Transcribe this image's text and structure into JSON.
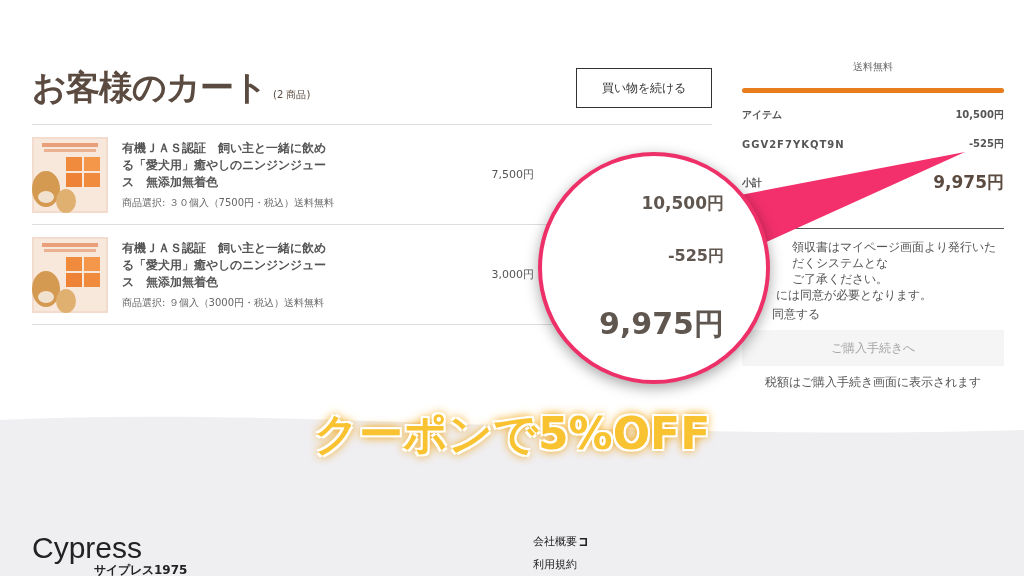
{
  "cart": {
    "title": "お客様のカート",
    "count": "(2 商品)",
    "continue_button": "買い物を続ける",
    "items": [
      {
        "kind": "picture",
        "name": "有機ＪＡＳ認証　飼い主と一緒に飲める「愛犬用」癒やしのニンジンジュース　無添加無着色",
        "option": "商品選択: ３０個入（7500円・税込）送料無料",
        "price": "7,500円"
      },
      {
        "kind": "picture",
        "name": "有機ＪＡＳ認証　飼い主と一緒に飲める「愛犬用」癒やしのニンジンジュース　無添加無着色",
        "option": "商品選択: ９個入（3000円・税込）送料無料",
        "price": "3,000円"
      }
    ]
  },
  "summary": {
    "shipping_label": "送料無料",
    "shipping_progress": {
      "level": 1
    },
    "rows": [
      {
        "label": "アイテム",
        "value": "10,500円",
        "kind": "line"
      },
      {
        "label": "GGV2F7YKQT9N",
        "value": "-525円",
        "kind": "coupon"
      },
      {
        "label": "小計",
        "value": "9,975円",
        "kind": "total"
      }
    ],
    "notes": [
      "領収書はマイページ画面より発行いただくシステムとな",
      "ご了承ください。",
      "には同意が必要となります。"
    ],
    "agree_label": "同意する",
    "checkout_button": {
      "label": "ご購入手続きへ",
      "disabled": true
    },
    "tax_note": "税額はご購入手続き画面に表示されます"
  },
  "annotation": {
    "magnified_values": [
      "10,500円",
      "-525円",
      "9,975円"
    ],
    "callout": "クーポンで5%OFF"
  },
  "footer": {
    "logo": "Cypress",
    "logo_sub": "サイプレス1975",
    "links": [
      {
        "label": "会社概要",
        "external": true
      },
      {
        "label": "利用規約",
        "external": false
      }
    ]
  }
}
